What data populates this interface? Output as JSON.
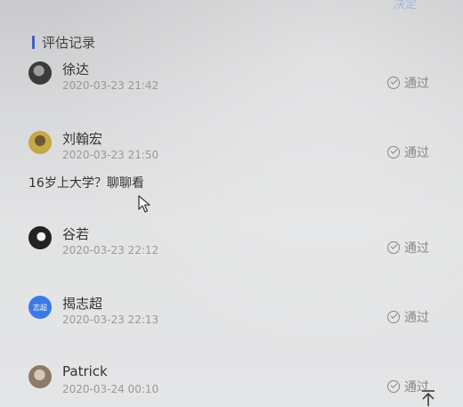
{
  "top_fragment": "决定",
  "section": {
    "title": "评估记录"
  },
  "records": [
    {
      "name": "徐达",
      "time": "2020-03-23 21:42",
      "status": "通过",
      "avatar": "photo-avatar"
    },
    {
      "name": "刘翰宏",
      "time": "2020-03-23 21:50",
      "status": "通过",
      "comment": "16岁上大学？聊聊看",
      "avatar": "photo-avatar"
    },
    {
      "name": "谷若",
      "time": "2020-03-23 22:12",
      "status": "通过",
      "avatar": "photo-avatar"
    },
    {
      "name": "揭志超",
      "time": "2020-03-23 22:13",
      "status": "通过",
      "avatar_text": "志超"
    },
    {
      "name": "Patrick",
      "time": "2020-03-24 00:10",
      "status": "通过",
      "avatar": "photo-avatar"
    }
  ],
  "icons": {
    "check": "check-circle-icon",
    "cursor": "mouse-cursor-icon",
    "back_to_top": "arrow-up-icon"
  },
  "colors": {
    "accent": "#3f5fc7",
    "text_avatar_bg": "#3b7ae6"
  }
}
